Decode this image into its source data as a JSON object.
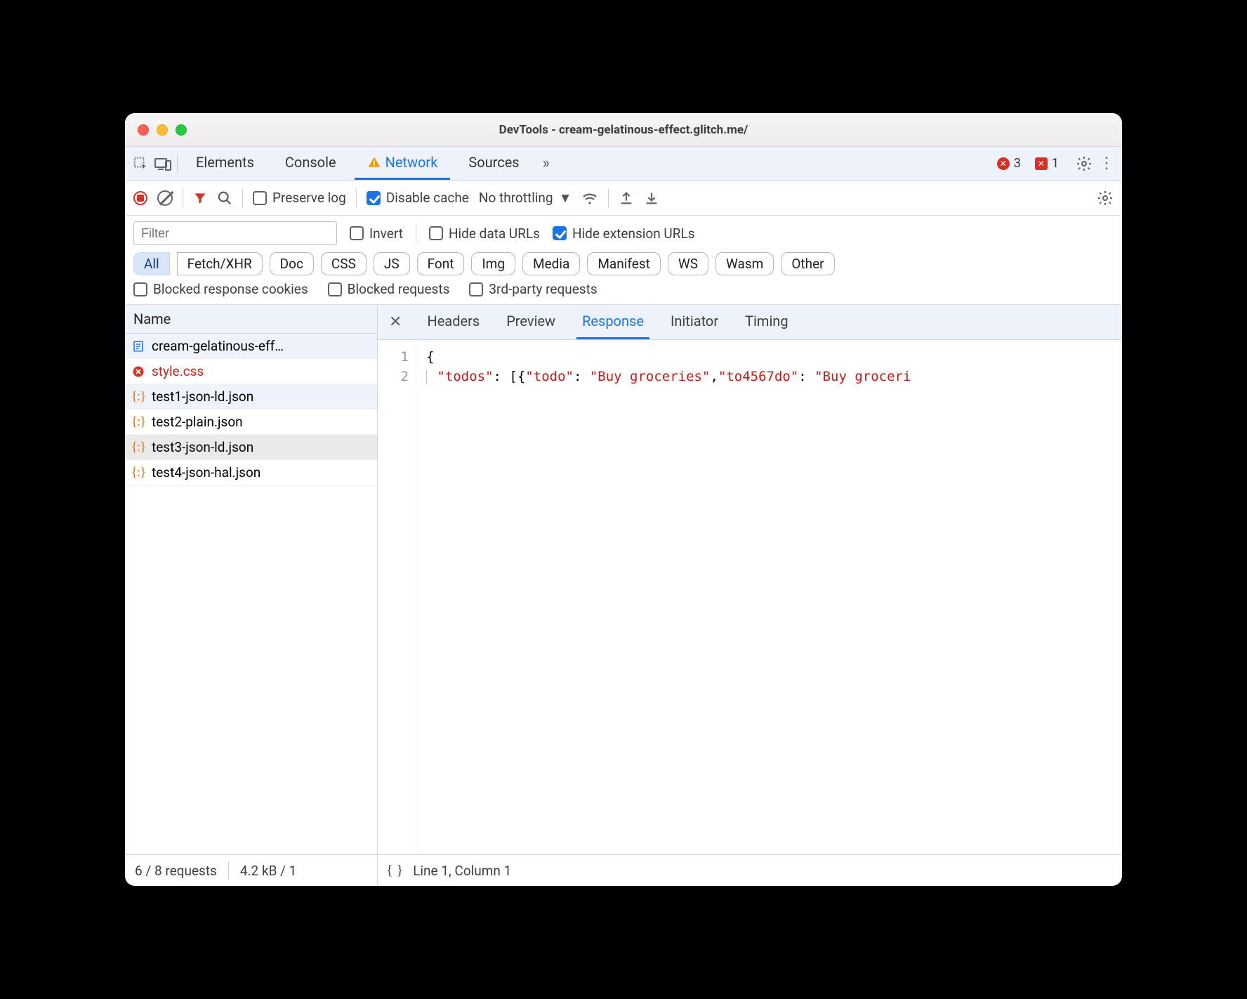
{
  "window": {
    "title": "DevTools - cream-gelatinous-effect.glitch.me/"
  },
  "top_tabs": {
    "items": [
      "Elements",
      "Console",
      "Network",
      "Sources"
    ],
    "active": "Network",
    "errors": "3",
    "issues": "1"
  },
  "controls": {
    "preserve_log": "Preserve log",
    "disable_cache": "Disable cache",
    "throttling": "No throttling"
  },
  "filter": {
    "placeholder": "Filter",
    "invert": "Invert",
    "hide_data_urls": "Hide data URLs",
    "hide_ext_urls": "Hide extension URLs"
  },
  "type_pills": [
    "All",
    "Fetch/XHR",
    "Doc",
    "CSS",
    "JS",
    "Font",
    "Img",
    "Media",
    "Manifest",
    "WS",
    "Wasm",
    "Other"
  ],
  "checks": {
    "blocked_cookies": "Blocked response cookies",
    "blocked_requests": "Blocked requests",
    "third_party": "3rd-party requests"
  },
  "requests": {
    "header": "Name",
    "list": [
      {
        "name": "cream-gelatinous-eff…",
        "icon": "doc",
        "state": "sel"
      },
      {
        "name": "style.css",
        "icon": "bad",
        "state": "err"
      },
      {
        "name": "test1-json-ld.json",
        "icon": "json",
        "state": "sel"
      },
      {
        "name": "test2-plain.json",
        "icon": "json",
        "state": ""
      },
      {
        "name": "test3-json-ld.json",
        "icon": "json",
        "state": "hov"
      },
      {
        "name": "test4-json-hal.json",
        "icon": "json",
        "state": ""
      }
    ]
  },
  "detail_tabs": [
    "Headers",
    "Preview",
    "Response",
    "Initiator",
    "Timing"
  ],
  "detail_active": "Response",
  "code": {
    "line1": "1",
    "line2": "2",
    "brace": "{",
    "body_key": "\"todos\"",
    "body_colon": ": [",
    "body_obrace": "{",
    "body_k1": "\"todo\"",
    "body_c1": ": ",
    "body_v1": "\"Buy groceries\"",
    "body_comma": ",",
    "body_k2": "\"to4567do\"",
    "body_c2": ": ",
    "body_v2": "\"Buy groceri"
  },
  "footer": {
    "requests": "6 / 8 requests",
    "size": "4.2 kB / 1",
    "pos": "Line 1, Column 1"
  }
}
